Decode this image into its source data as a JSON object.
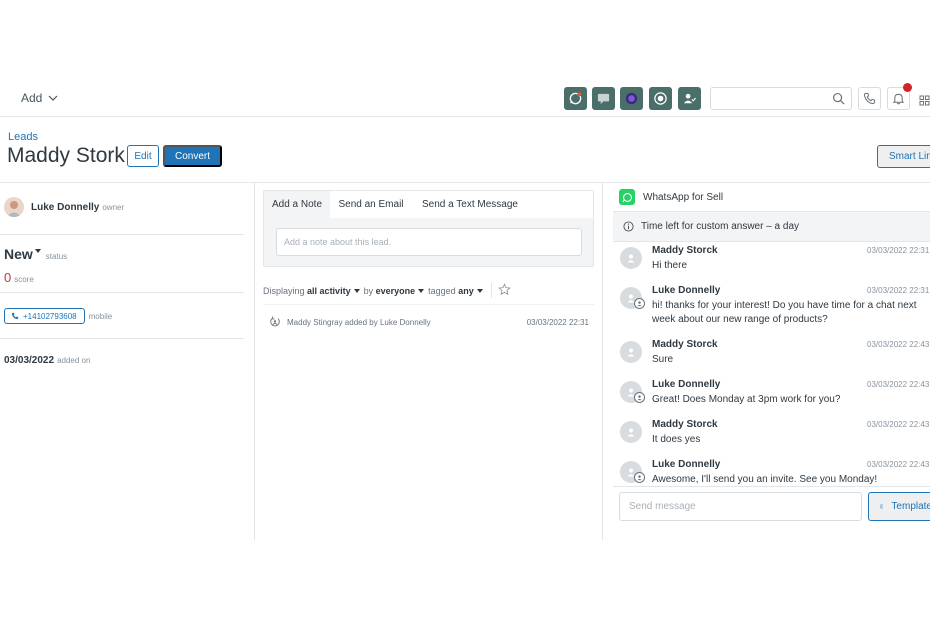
{
  "topbar": {
    "add_label": "Add",
    "search_placeholder": "",
    "icons": [
      "whatsapp-icon",
      "chat-icon",
      "app-icon",
      "target-icon",
      "user-check-icon"
    ],
    "colors": {
      "icon_bg": "#4a6e6a",
      "notif": "#d1232a"
    }
  },
  "header": {
    "breadcrumb": "Leads",
    "title": "Maddy Stork",
    "edit_label": "Edit",
    "convert_label": "Convert",
    "smart_links_label": "Smart Links"
  },
  "details": {
    "owner_name": "Luke Donnelly",
    "owner_label": "owner",
    "status_value": "New",
    "status_label": "status",
    "score_value": "0",
    "score_label": "score",
    "phone_value": "+14102793608",
    "phone_label": "mobile",
    "added_value": "03/03/2022",
    "added_label": "added on"
  },
  "activity": {
    "tabs": [
      "Add a Note",
      "Send an Email",
      "Send a Text Message"
    ],
    "note_placeholder": "Add a note about this lead.",
    "filter": {
      "prefix": "Displaying",
      "activity_value": "all activity",
      "by_label": "by",
      "by_value": "everyone",
      "tagged_label": "tagged",
      "tagged_value": "any"
    },
    "items": [
      {
        "text": "Maddy Stingray added by Luke Donnelly",
        "time": "03/03/2022 22:31"
      }
    ]
  },
  "whatsapp": {
    "title": "WhatsApp for Sell",
    "banner": "Time left for custom answer – a day",
    "messages": [
      {
        "name": "Maddy Storck",
        "time": "03/03/2022 22:31",
        "text": "Hi there",
        "agent": false
      },
      {
        "name": "Luke Donnelly",
        "time": "03/03/2022 22:31",
        "text": "hi! thanks for your interest! Do you have time for a chat next week about our new range of products?",
        "agent": true
      },
      {
        "name": "Maddy Storck",
        "time": "03/03/2022 22:43",
        "text": "Sure",
        "agent": false
      },
      {
        "name": "Luke Donnelly",
        "time": "03/03/2022 22:43",
        "text": "Great! Does Monday at 3pm work for you?",
        "agent": true
      },
      {
        "name": "Maddy Storck",
        "time": "03/03/2022 22:43",
        "text": "It does yes",
        "agent": false
      },
      {
        "name": "Luke Donnelly",
        "time": "03/03/2022 22:43",
        "text": "Awesome, I'll send you an invite. See you Monday!",
        "agent": true
      }
    ],
    "send_placeholder": "Send message",
    "templates_label": "Templates",
    "colors": {
      "brand": "#25d366",
      "accent": "#1f73b7"
    }
  }
}
